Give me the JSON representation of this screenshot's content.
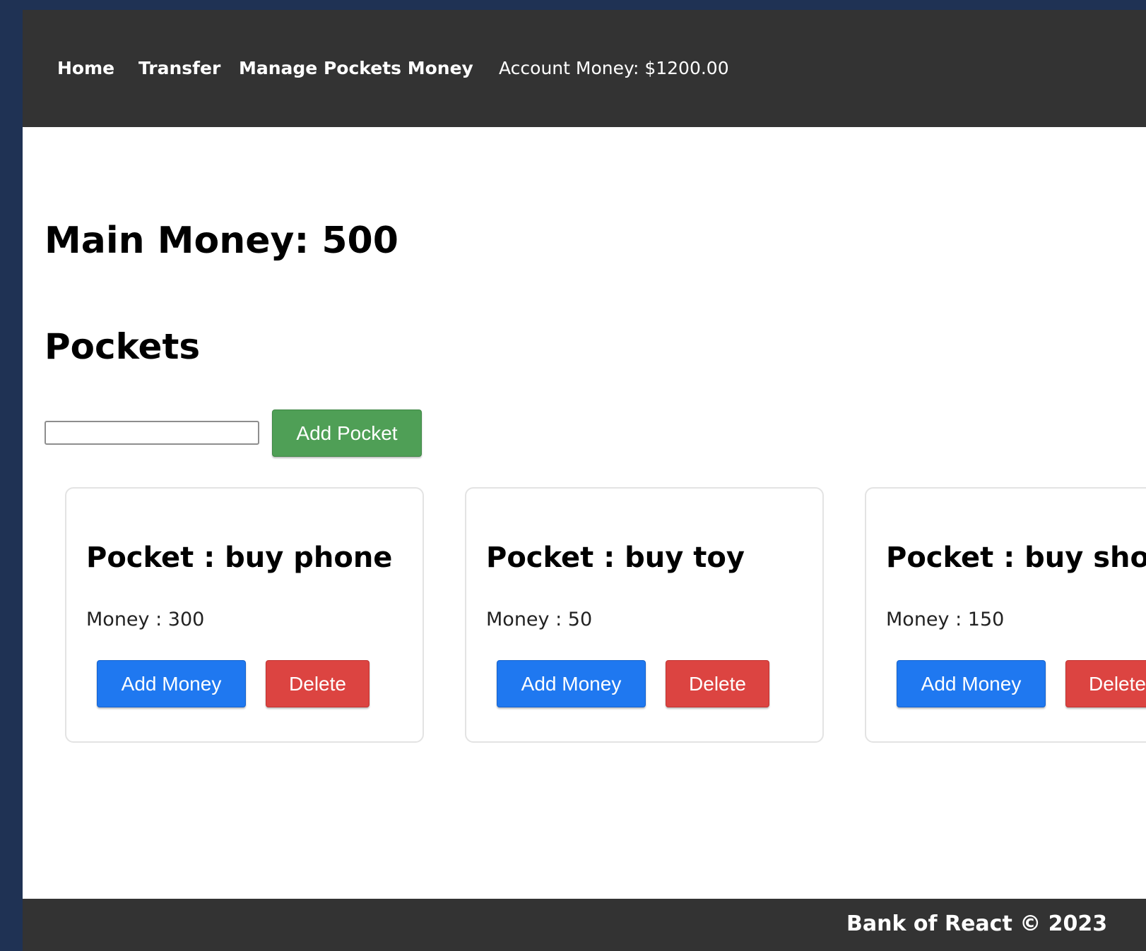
{
  "nav": {
    "home": "Home",
    "transfer": "Transfer",
    "manage": "Manage Pockets Money",
    "account_money": "Account Money: $1200.00"
  },
  "main": {
    "main_money": "Main Money: 500",
    "pockets_heading": "Pockets",
    "input_value": "",
    "add_pocket_label": "Add Pocket"
  },
  "pockets": [
    {
      "title": "Pocket : buy phone",
      "money": "Money : 300",
      "add_label": "Add Money",
      "delete_label": "Delete"
    },
    {
      "title": "Pocket : buy toy",
      "money": "Money : 50",
      "add_label": "Add Money",
      "delete_label": "Delete"
    },
    {
      "title": "Pocket : buy shoe",
      "money": "Money : 150",
      "add_label": "Add Money",
      "delete_label": "Delete"
    }
  ],
  "footer": {
    "text": "Bank of React © 2023"
  },
  "colors": {
    "navbar": "#333333",
    "add_pocket": "#4f9f56",
    "add_money": "#1f78f0",
    "delete": "#dc4441"
  }
}
